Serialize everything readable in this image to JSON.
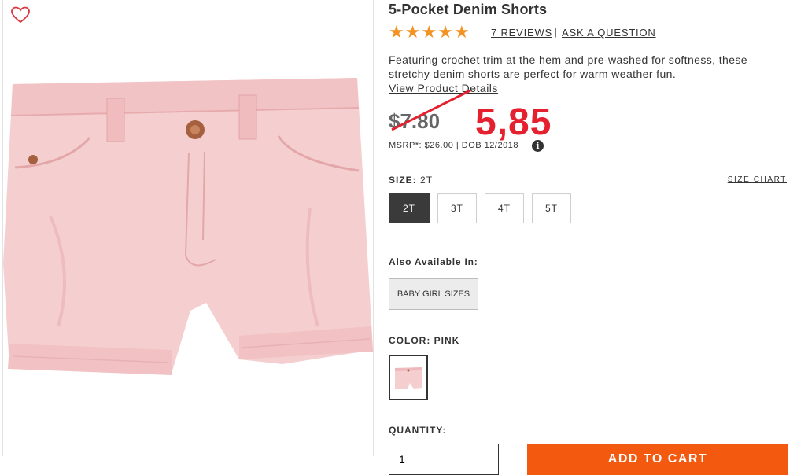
{
  "product": {
    "title": "5-Pocket Denim Shorts",
    "rating_stars": 5,
    "reviews_link": "7 REVIEWS",
    "separator": "|",
    "ask_link": "ASK A QUESTION",
    "description": "Featuring crochet trim at the hem and pre-washed for softness, these stretchy denim shorts are perfect for warm weather fun.",
    "view_details": "View Product Details",
    "price": "$7.80",
    "price_annotation": "5,85",
    "msrp": "MSRP*: $26.00 | DOB 12/2018",
    "info_icon": "i"
  },
  "size": {
    "label": "SIZE:",
    "selected": "2T",
    "chart_link": "SIZE CHART",
    "options": [
      "2T",
      "3T",
      "4T",
      "5T"
    ]
  },
  "also_available": {
    "label": "Also Available In:",
    "button": "BABY GIRL SIZES"
  },
  "color": {
    "label": "COLOR: PINK"
  },
  "quantity": {
    "label": "QUANTITY:",
    "value": "1"
  },
  "cart": {
    "button": "ADD TO CART"
  },
  "colors": {
    "star": "#f39323",
    "annotation": "#e52130",
    "cta": "#f35a0f",
    "product_pink": "#f5cfcf"
  }
}
